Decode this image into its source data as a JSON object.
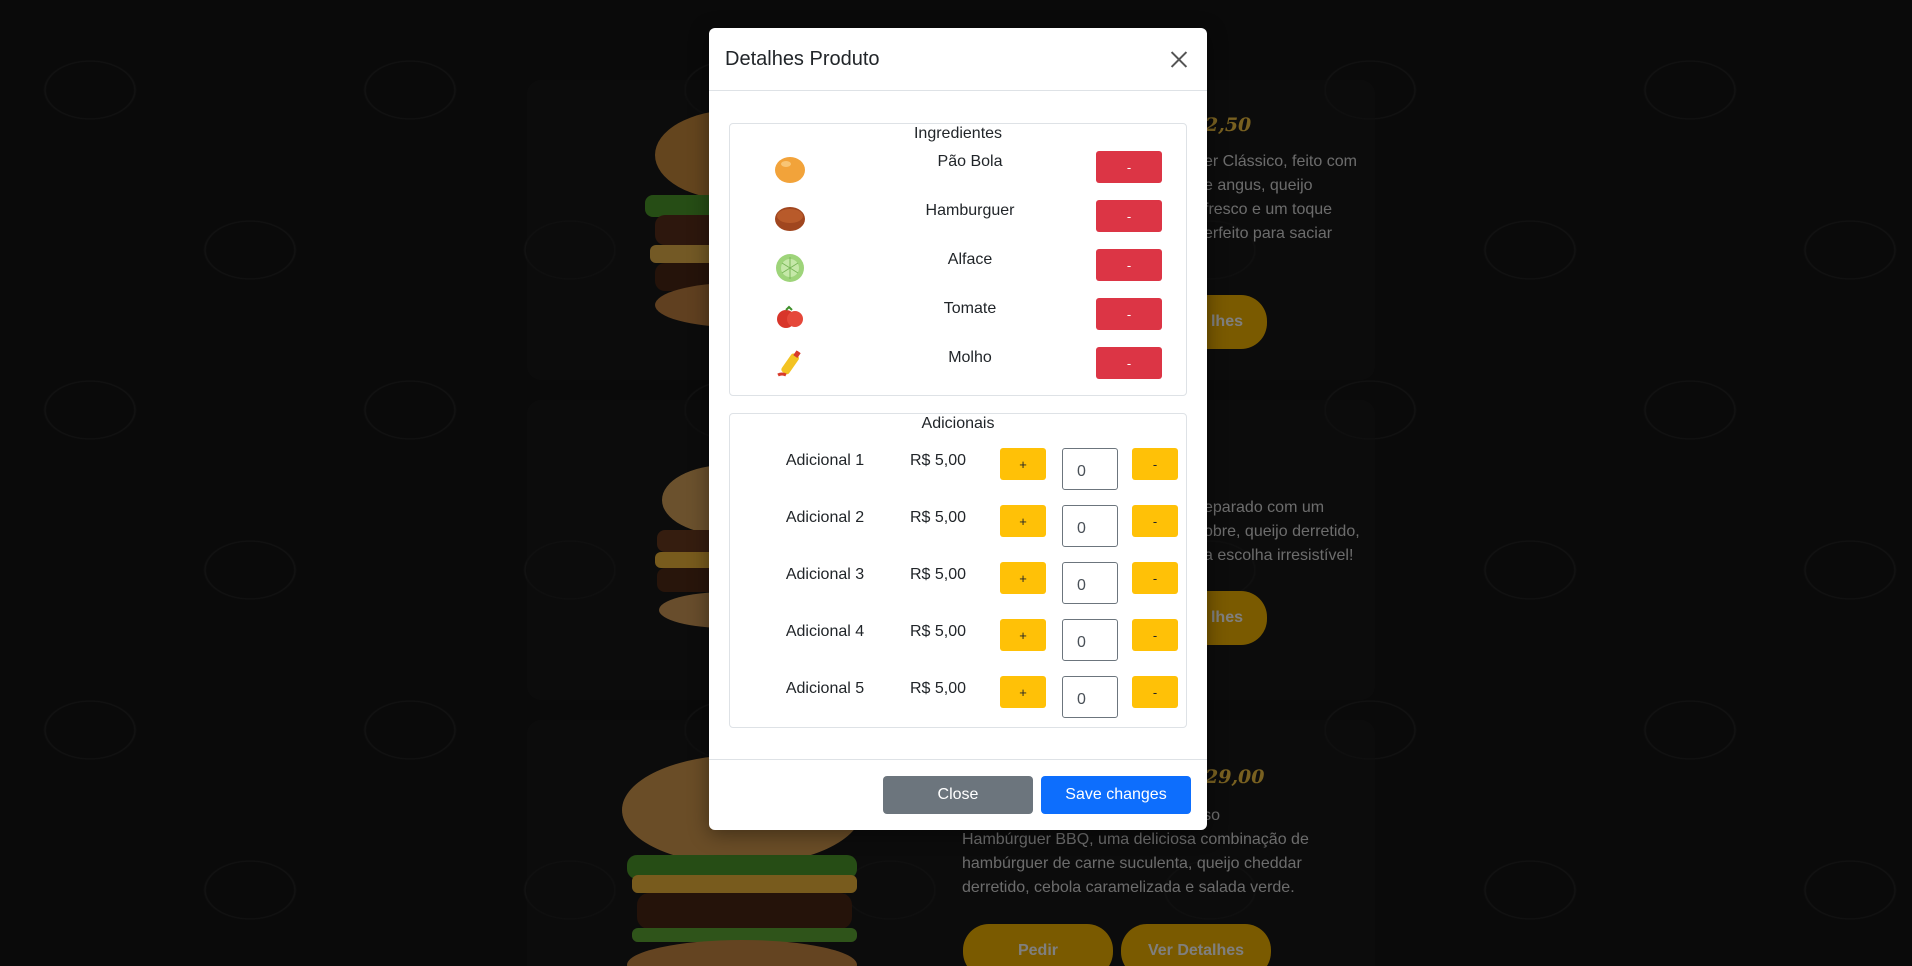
{
  "background": {
    "cards": [
      {
        "price": "2,50",
        "description": [
          "er Clássico, feito com",
          "e angus, queijo",
          "fresco e um toque",
          "erfeito para saciar"
        ],
        "details_label": "lhes"
      },
      {
        "description": [
          "eparado com um",
          "obre, queijo derretido,",
          "a escolha irresistível!"
        ],
        "details_label": "lhes"
      },
      {
        "price": "29,00",
        "description": [
          "nado do nosso",
          "Hambúrguer BBQ, uma deliciosa combinação de",
          "hambúrguer de carne suculenta, queijo cheddar",
          "derretido, cebola caramelizada e salada verde."
        ],
        "order_label": "Pedir",
        "details_label": "Ver Detalhes"
      }
    ]
  },
  "modal": {
    "title": "Detalhes Produto",
    "ingredients": {
      "title": "Ingredientes",
      "items": [
        {
          "name": "Pão Bola",
          "icon": "bread-bun-icon",
          "remove_label": "-"
        },
        {
          "name": "Hamburguer",
          "icon": "patty-icon",
          "remove_label": "-"
        },
        {
          "name": "Alface",
          "icon": "lettuce-icon",
          "remove_label": "-"
        },
        {
          "name": "Tomate",
          "icon": "tomato-icon",
          "remove_label": "-"
        },
        {
          "name": "Molho",
          "icon": "sauce-bottle-icon",
          "remove_label": "-"
        }
      ]
    },
    "additionals": {
      "title": "Adicionais",
      "items": [
        {
          "name": "Adicional 1",
          "price": "R$ 5,00",
          "plus_label": "+",
          "quantity": "0",
          "minus_label": "-"
        },
        {
          "name": "Adicional 2",
          "price": "R$ 5,00",
          "plus_label": "+",
          "quantity": "0",
          "minus_label": "-"
        },
        {
          "name": "Adicional 3",
          "price": "R$ 5,00",
          "plus_label": "+",
          "quantity": "0",
          "minus_label": "-"
        },
        {
          "name": "Adicional 4",
          "price": "R$ 5,00",
          "plus_label": "+",
          "quantity": "0",
          "minus_label": "-"
        },
        {
          "name": "Adicional 5",
          "price": "R$ 5,00",
          "plus_label": "+",
          "quantity": "0",
          "minus_label": "-"
        }
      ]
    },
    "footer": {
      "close_label": "Close",
      "save_label": "Save changes"
    }
  },
  "colors": {
    "danger": "#dc3545",
    "warning": "#ffc107",
    "primary": "#0d6efd",
    "secondary": "#6c757d",
    "accent_gold": "#f4b400"
  }
}
